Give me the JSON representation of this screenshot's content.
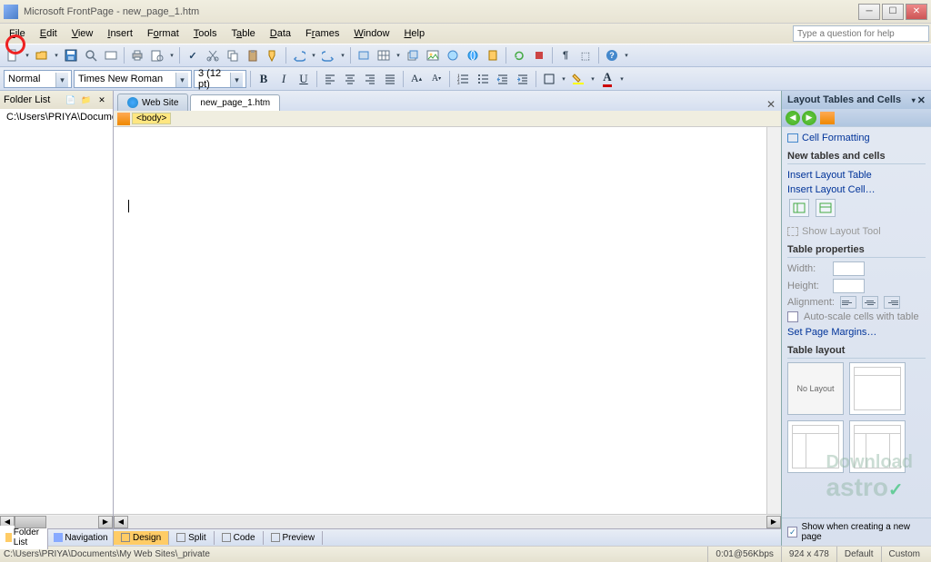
{
  "title": "Microsoft FrontPage - new_page_1.htm",
  "menus": [
    "File",
    "Edit",
    "View",
    "Insert",
    "Format",
    "Tools",
    "Table",
    "Data",
    "Frames",
    "Window",
    "Help"
  ],
  "helpbox_placeholder": "Type a question for help",
  "style_combo": "Normal",
  "font_combo": "Times New Roman",
  "size_combo": "3 (12 pt)",
  "folder_header": "Folder List",
  "folder_root": "C:\\Users\\PRIYA\\Document",
  "bottom_tabs": [
    "Folder List",
    "Navigation"
  ],
  "doc_tabs": [
    {
      "label": "Web Site",
      "active": false
    },
    {
      "label": "new_page_1.htm",
      "active": true
    }
  ],
  "tag_path": "<body>",
  "editor_tabs": [
    "Design",
    "Split",
    "Code",
    "Preview"
  ],
  "taskpane": {
    "title": "Layout Tables and Cells",
    "cell_formatting": "Cell Formatting",
    "section_new": "New tables and cells",
    "insert_table": "Insert Layout Table",
    "insert_cell": "Insert Layout Cell…",
    "show_tool": "Show Layout Tool",
    "section_props": "Table properties",
    "width_label": "Width:",
    "height_label": "Height:",
    "align_label": "Alignment:",
    "autoscale": "Auto-scale cells with table",
    "set_margins": "Set Page Margins…",
    "section_layout": "Table layout",
    "no_layout": "No Layout",
    "footer_check": "Show when creating a new page"
  },
  "status": {
    "path": "C:\\Users\\PRIYA\\Documents\\My Web Sites\\_private",
    "speed": "0:01@56Kbps",
    "size": "924 x 478",
    "mode1": "Default",
    "mode2": "Custom"
  },
  "watermark": "Download\nastro"
}
